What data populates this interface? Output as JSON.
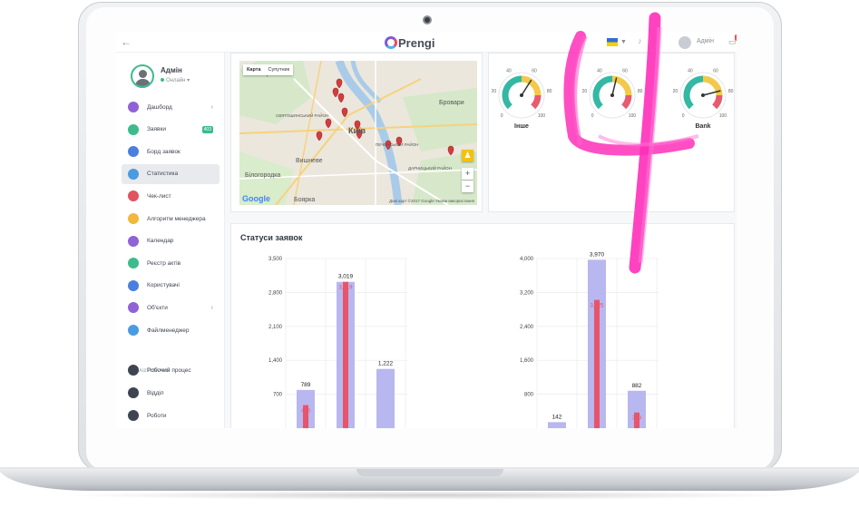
{
  "topbar": {
    "back_icon": "arrow-left-icon",
    "logo_text": "Prengi",
    "language": "UA",
    "user_name": "Адмін",
    "notifications": "0"
  },
  "profile": {
    "name": "Адмін",
    "status": "Онлайн"
  },
  "nav": [
    {
      "label": "Дашборд",
      "icon": "monitor-icon",
      "color": "#8f62d6",
      "chevron": true
    },
    {
      "label": "Заявки",
      "icon": "ticket-icon",
      "color": "#3dbb8c",
      "badge": "403"
    },
    {
      "label": "Борд заявок",
      "icon": "grid-icon",
      "color": "#4a7fe0"
    },
    {
      "label": "Статистика",
      "icon": "chart-icon",
      "color": "#4a9be0",
      "active": true
    },
    {
      "label": "Чек-лист",
      "icon": "checklist-icon",
      "color": "#e2525f"
    },
    {
      "label": "Алгоритм менеджера",
      "icon": "bulb-icon",
      "color": "#f1b83b"
    },
    {
      "label": "Календар",
      "icon": "calendar-icon",
      "color": "#8f62d6"
    },
    {
      "label": "Реєстр актів",
      "icon": "registry-icon",
      "color": "#3dbb8c"
    },
    {
      "label": "Користувачі",
      "icon": "users-icon",
      "color": "#4a7fe0"
    },
    {
      "label": "Об'єкти",
      "icon": "building-icon",
      "color": "#8f62d6",
      "chevron": true
    },
    {
      "label": "Файлменеджер",
      "icon": "image-icon",
      "color": "#4a9be0"
    }
  ],
  "settings_section": "НАЛАШТУВАННЯ",
  "settings_nav": [
    {
      "label": "Робочий процес",
      "icon": "workflow-icon",
      "color": "#3e4450"
    },
    {
      "label": "Відділ",
      "icon": "department-icon",
      "color": "#3e4450"
    },
    {
      "label": "Роботи",
      "icon": "tools-icon",
      "color": "#3e4450"
    }
  ],
  "map": {
    "tab_map": "Карта",
    "tab_satellite": "Супутник",
    "places": [
      "Ірпінь",
      "Бровари",
      "Київ",
      "Вишневе",
      "Боярка",
      "Білогородка",
      "СВЯТОШИНСЬКИЙ РАЙОН",
      "ДАРНИЦЬКИЙ РАЙОН",
      "ПЕЧЕРСЬКИЙ РАЙОН"
    ],
    "footer": "Дані карт ©2017 Google   Умови використання",
    "google": "Google",
    "zoom_in": "+",
    "zoom_out": "−"
  },
  "gauges": [
    {
      "label": "Інше",
      "value": 62
    },
    {
      "label": "",
      "value": 55
    },
    {
      "label": "Bank",
      "value": 78
    }
  ],
  "gauge_ticks": [
    "0",
    "10",
    "20",
    "30",
    "40",
    "50",
    "60",
    "70",
    "80",
    "90",
    "100"
  ],
  "status_panel": {
    "title": "Статуси заявок"
  },
  "chart_data": [
    {
      "type": "bar",
      "ylim": [
        0,
        3500
      ],
      "yticks": [
        "700",
        "1,400",
        "2,100",
        "2,800",
        "3,500"
      ],
      "categories": [
        "",
        "",
        ""
      ],
      "series": [
        {
          "values": [
            789,
            3019,
            1222
          ]
        },
        {
          "values": [
            475,
            3019,
            null
          ]
        }
      ],
      "total_labels": [
        "789",
        "3,019",
        "1,222"
      ],
      "inner_labels": [
        "475",
        "3,019",
        ""
      ]
    },
    {
      "type": "bar",
      "ylim": [
        0,
        4000
      ],
      "yticks": [
        "800",
        "1,600",
        "2,400",
        "3,200",
        "4,000"
      ],
      "categories": [
        "",
        "",
        ""
      ],
      "series": [
        {
          "values": [
            142,
            3970,
            882
          ]
        },
        {
          "values": [
            null,
            3025,
            369
          ]
        }
      ],
      "total_labels": [
        "142",
        "3,970",
        "882"
      ],
      "inner_labels": [
        "",
        "3,025",
        "369"
      ]
    }
  ],
  "colors": {
    "bar_light": "#b9b7ef",
    "bar_red": "#e8546a",
    "accent": "#3dbb8c",
    "stroke": "#ff2fb9"
  }
}
